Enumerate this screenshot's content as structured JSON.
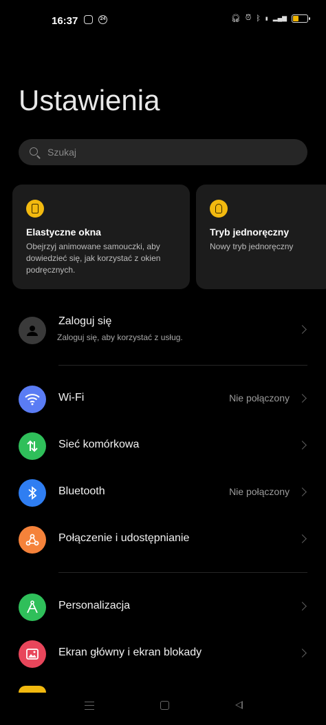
{
  "status_bar": {
    "time": "16:37",
    "left_icons": [
      "instagram-icon",
      "notification-24-icon"
    ],
    "badge_24": "24",
    "right_icons": [
      "headphones-icon",
      "alarm-icon",
      "bluetooth-icon",
      "volte-icon",
      "signal-icon",
      "battery-icon"
    ],
    "battery_level": 0.35,
    "battery_color": "#f2b600"
  },
  "header": {
    "title": "Ustawienia"
  },
  "search": {
    "placeholder": "Szukaj"
  },
  "tips": [
    {
      "title": "Elastyczne okna",
      "description": "Obejrzyj animowane samouczki, aby dowiedzieć się, jak korzystać z okien podręcznych.",
      "icon": "flexible-window-icon"
    },
    {
      "title": "Tryb jednoręczny",
      "description": "Nowy tryb jednoręczny",
      "icon": "one-hand-mode-icon"
    }
  ],
  "account": {
    "title": "Zaloguj się",
    "subtitle": "Zaloguj się, aby korzystać z usług.",
    "icon": "avatar-icon"
  },
  "settings": [
    {
      "label": "Wi-Fi",
      "value": "Nie połączony",
      "icon": "wifi-icon",
      "color": "#5a7cf4"
    },
    {
      "label": "Sieć komórkowa",
      "value": "",
      "icon": "mobile-data-icon",
      "color": "#2fbf5a"
    },
    {
      "label": "Bluetooth",
      "value": "Nie połączony",
      "icon": "bluetooth-icon",
      "color": "#2f7ef2"
    },
    {
      "label": "Połączenie i udostępnianie",
      "value": "",
      "icon": "connection-sharing-icon",
      "color": "#f5823a"
    },
    {
      "label": "Personalizacja",
      "value": "",
      "icon": "personalization-icon",
      "color": "#2fbf5a"
    },
    {
      "label": "Ekran główny i ekran blokady",
      "value": "",
      "icon": "home-lock-screen-icon",
      "color": "#e8465b"
    }
  ],
  "partial_item_color": "#f2b90f",
  "nav": {
    "icons": [
      "menu-icon",
      "home-icon",
      "back-icon"
    ]
  }
}
